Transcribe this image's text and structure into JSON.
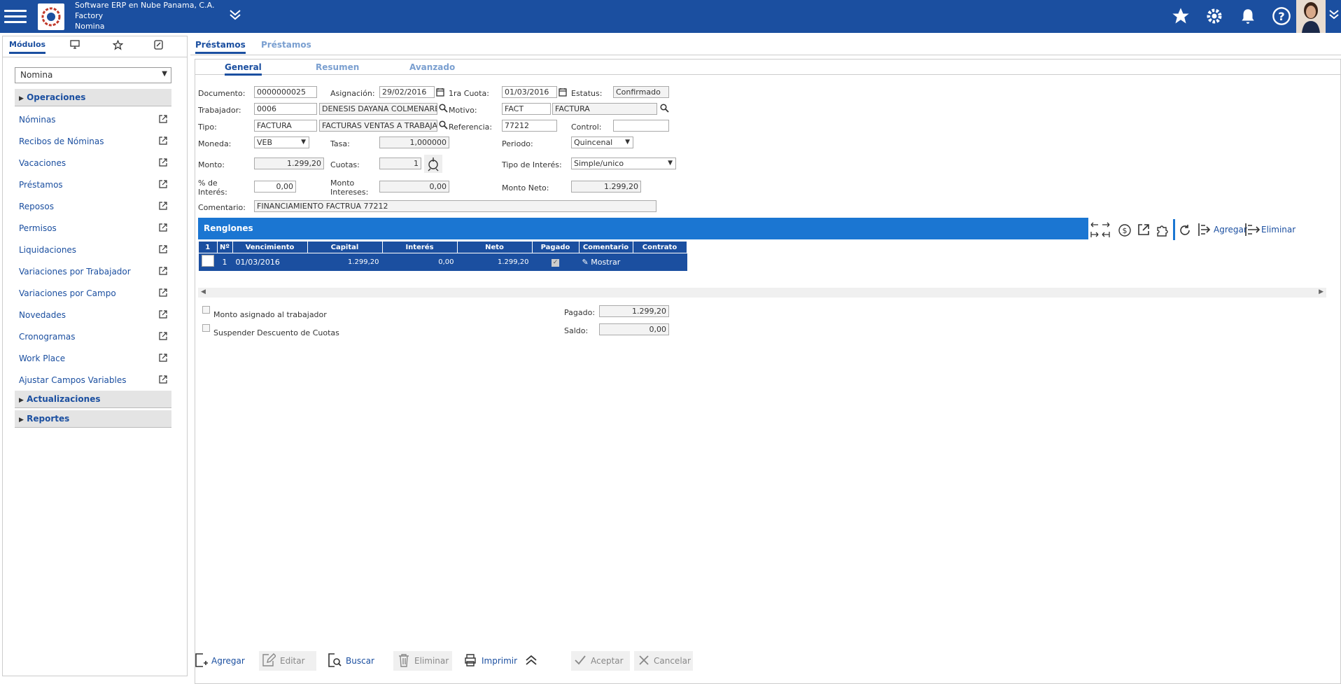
{
  "header": {
    "company": "Software ERP en Nube Panama, C.A.",
    "subtitle": "Factory",
    "module": "Nomina"
  },
  "left": {
    "tabs": [
      "Módulos"
    ],
    "module_select": "Nomina",
    "groups": {
      "operaciones": "Operaciones",
      "actualizaciones": "Actualizaciones",
      "reportes": "Reportes"
    },
    "items": [
      "Nóminas",
      "Recibos de Nóminas",
      "Vacaciones",
      "Préstamos",
      "Reposos",
      "Permisos",
      "Liquidaciones",
      "Variaciones por Trabajador",
      "Variaciones por Campo",
      "Novedades",
      "Cronogramas",
      "Work Place",
      "Ajustar Campos Variables"
    ]
  },
  "main": {
    "tabs": [
      "Préstamos",
      "Préstamos"
    ],
    "subtabs": [
      "General",
      "Resumen",
      "Avanzado"
    ]
  },
  "form": {
    "documento_label": "Documento:",
    "documento": "0000000025",
    "asignacion_label": "Asignación:",
    "asignacion": "29/02/2016",
    "cuota_label": "1ra Cuota:",
    "cuota": "01/03/2016",
    "estatus_label": "Estatus:",
    "estatus": "Confirmado",
    "trabajador_label": "Trabajador:",
    "trabajador_code": "0006",
    "trabajador_name": "DENESIS DAYANA COLMENARES",
    "motivo_label": "Motivo:",
    "motivo_code": "FACT",
    "motivo_name": "FACTURA",
    "tipo_label": "Tipo:",
    "tipo_code": "FACTURA",
    "tipo_name": "FACTURAS VENTAS A TRABAJADORES",
    "referencia_label": "Referencia:",
    "referencia": "77212",
    "control_label": "Control:",
    "control": "",
    "moneda_label": "Moneda:",
    "moneda": "VEB",
    "tasa_label": "Tasa:",
    "tasa": "1,000000",
    "periodo_label": "Periodo:",
    "periodo": "Quincenal",
    "monto_label": "Monto:",
    "monto": "1.299,20",
    "cuotas_label": "Cuotas:",
    "cuotas": "1",
    "tipo_interes_label": "Tipo de Interés:",
    "tipo_interes": "Simple/unico",
    "pct_interes_label": "% de Interés:",
    "pct_interes": "0,00",
    "monto_intereses_label": "Monto Intereses:",
    "monto_intereses": "0,00",
    "monto_neto_label": "Monto Neto:",
    "monto_neto": "1.299,20",
    "comentario_label": "Comentario:",
    "comentario": "FINANCIAMIENTO FACTRUA 77212"
  },
  "renglones": {
    "title": "Renglones",
    "agregar": "Agregar",
    "eliminar": "Eliminar",
    "columns": [
      "1",
      "Nº",
      "Vencimiento",
      "Capital",
      "Interés",
      "Neto",
      "Pagado",
      "Comentario",
      "Contrato"
    ],
    "rows": [
      {
        "n": "1",
        "vencimiento": "01/03/2016",
        "capital": "1.299,20",
        "interes": "0,00",
        "neto": "1.299,20",
        "comentario": "Mostrar",
        "contrato": ""
      }
    ]
  },
  "summary": {
    "monto_asignado": "Monto asignado al trabajador",
    "suspender": "Suspender Descuento de Cuotas",
    "pagado_label": "Pagado:",
    "pagado": "1.299,20",
    "saldo_label": "Saldo:",
    "saldo": "0,00"
  },
  "toolbar": {
    "agregar": "Agregar",
    "editar": "Editar",
    "buscar": "Buscar",
    "eliminar": "Eliminar",
    "imprimir": "Imprimir",
    "aceptar": "Aceptar",
    "cancelar": "Cancelar"
  }
}
